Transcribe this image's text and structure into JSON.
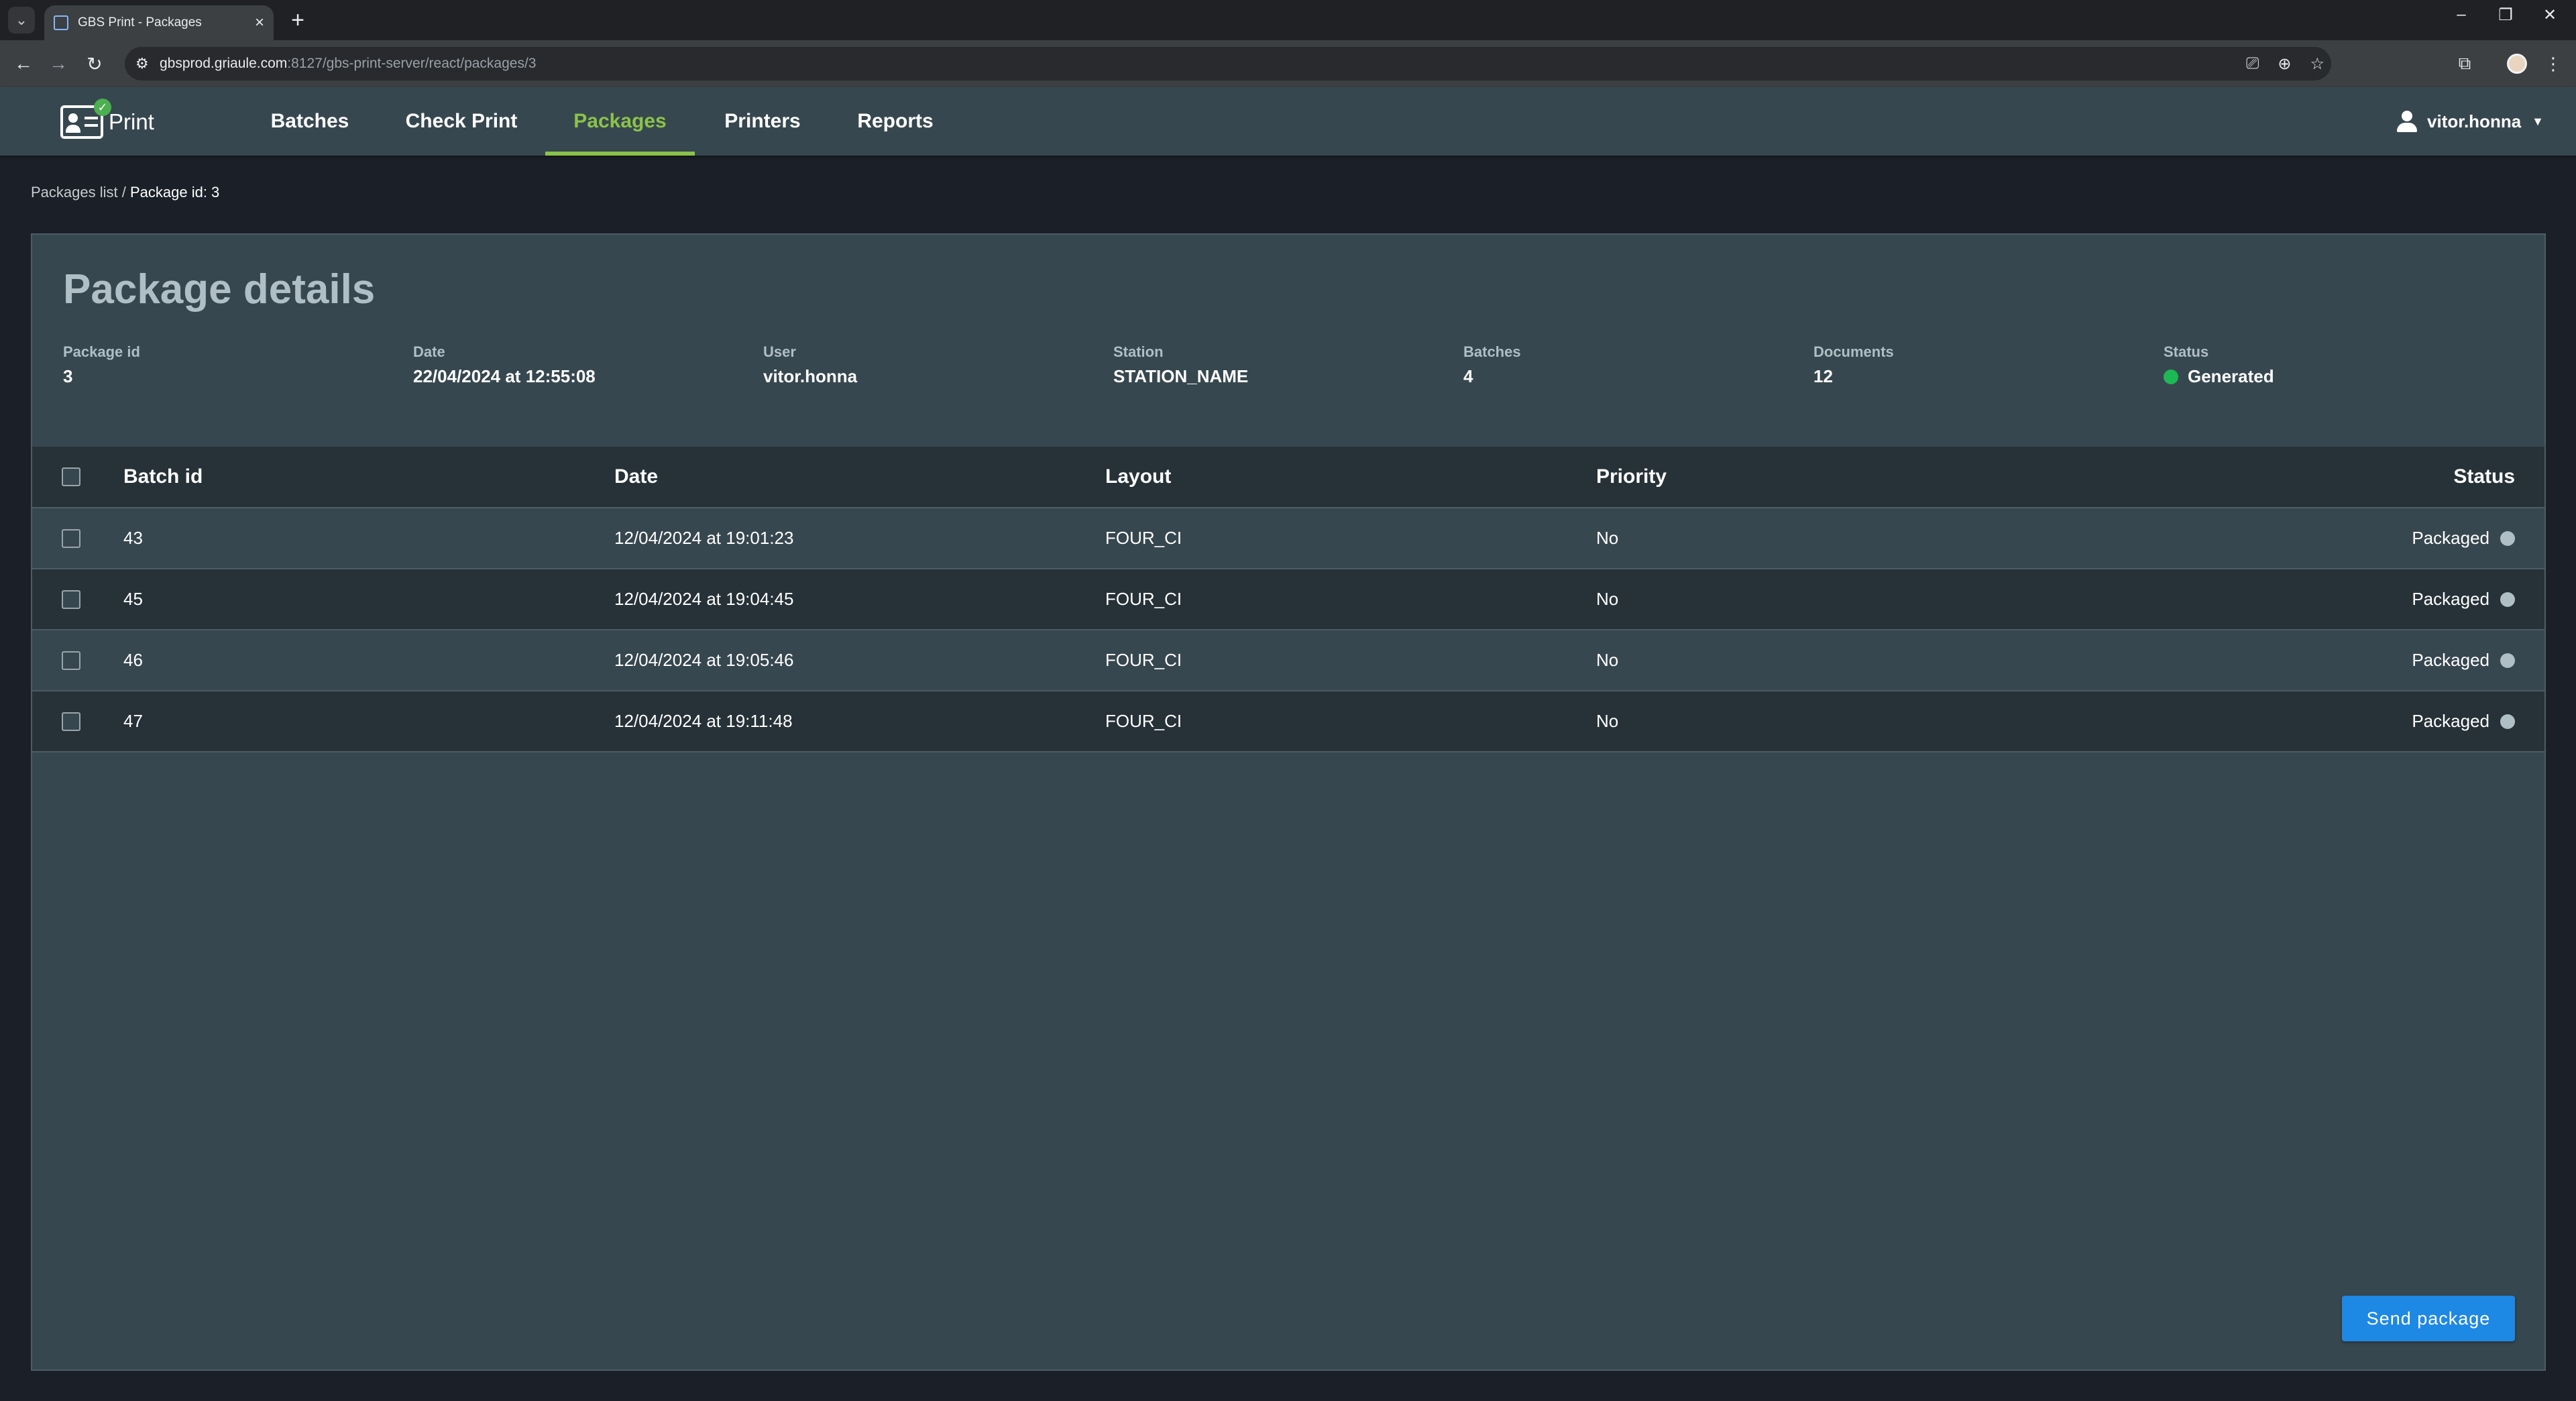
{
  "browser": {
    "tab_title": "GBS Print - Packages",
    "url_host": "gbsprod.griaule.com",
    "url_path": ":8127/gbs-print-server/react/packages/3"
  },
  "app": {
    "logo_text": "Print",
    "nav": [
      {
        "label": "Batches"
      },
      {
        "label": "Check Print"
      },
      {
        "label": "Packages"
      },
      {
        "label": "Printers"
      },
      {
        "label": "Reports"
      }
    ],
    "user": "vitor.honna"
  },
  "breadcrumb": {
    "parent": "Packages list",
    "separator": " / ",
    "current": "Package id: 3"
  },
  "package": {
    "title": "Package details",
    "fields": [
      {
        "label": "Package id",
        "value": "3"
      },
      {
        "label": "Date",
        "value": "22/04/2024 at 12:55:08"
      },
      {
        "label": "User",
        "value": "vitor.honna"
      },
      {
        "label": "Station",
        "value": "STATION_NAME"
      },
      {
        "label": "Batches",
        "value": "4"
      },
      {
        "label": "Documents",
        "value": "12"
      },
      {
        "label": "Status",
        "value": "Generated"
      }
    ],
    "status_color": "#1db954"
  },
  "table": {
    "headers": {
      "batch_id": "Batch id",
      "date": "Date",
      "layout": "Layout",
      "priority": "Priority",
      "status": "Status"
    },
    "rows": [
      {
        "batch_id": "43",
        "date": "12/04/2024 at 19:01:23",
        "layout": "FOUR_CI",
        "priority": "No",
        "status": "Packaged"
      },
      {
        "batch_id": "45",
        "date": "12/04/2024 at 19:04:45",
        "layout": "FOUR_CI",
        "priority": "No",
        "status": "Packaged"
      },
      {
        "batch_id": "46",
        "date": "12/04/2024 at 19:05:46",
        "layout": "FOUR_CI",
        "priority": "No",
        "status": "Packaged"
      },
      {
        "batch_id": "47",
        "date": "12/04/2024 at 19:11:48",
        "layout": "FOUR_CI",
        "priority": "No",
        "status": "Packaged"
      }
    ]
  },
  "actions": {
    "send_label": "Send package"
  },
  "colors": {
    "accent": "#8bc34a",
    "button": "#1e88e5",
    "panel": "#37474f",
    "panel_dark": "#263238"
  }
}
